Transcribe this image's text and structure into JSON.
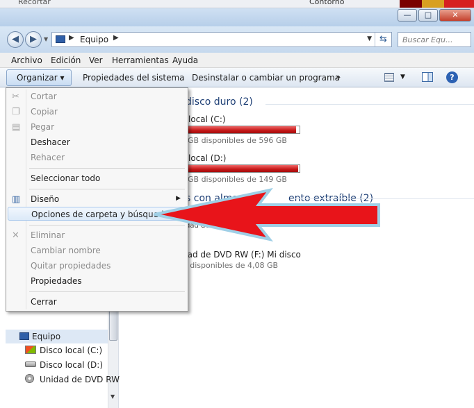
{
  "background_app": {
    "left_label": "Recortar",
    "right_label": "Contorno"
  },
  "window": {
    "min": "—",
    "max": "□",
    "close": "✕"
  },
  "address": {
    "crumb": "Equipo",
    "search_placeholder": "Buscar Equ..."
  },
  "menubar": [
    "Archivo",
    "Edición",
    "Ver",
    "Herramientas",
    "Ayuda"
  ],
  "toolbar": {
    "organize": "Organizar ▾",
    "properties": "Propiedades del sistema",
    "uninstall": "Desinstalar o cambiar un programa",
    "more": "»"
  },
  "nav": {
    "equipo": "Equipo",
    "items": [
      "Disco local (C:)",
      "Disco local (D:)",
      "Unidad de DVD RW"
    ]
  },
  "content": {
    "hdd_group": "disco duro (2)",
    "drive_c_name": "local (C:)",
    "drive_c_free": "GB disponibles de 596 GB",
    "drive_c_used_fraction": 0.97,
    "drive_d_name": "local (D:)",
    "drive_d_free": "GB disponibles de 149 GB",
    "drive_d_used_fraction": 0.99,
    "removable_group_a": "s con alma",
    "removable_group_b": "ento extraíble (2)",
    "hidden_drive_name": "dad de DD",
    "dvd_name": "dad de DVD RW (F:) Mi disco",
    "dvd_free": "s disponibles de 4,08 GB"
  },
  "menu": {
    "cut": "Cortar",
    "copy": "Copiar",
    "paste": "Pegar",
    "undo": "Deshacer",
    "redo": "Rehacer",
    "select_all": "Seleccionar todo",
    "layout": "Diseño",
    "folder_options": "Opciones de carpeta y búsqueda",
    "delete": "Eliminar",
    "rename": "Cambiar nombre",
    "remove_props": "Quitar propiedades",
    "properties": "Propiedades",
    "close": "Cerrar"
  },
  "colors": {
    "arrow": "#e8141a",
    "arrow_border": "#9fcfe6",
    "drive_bar": "#c41717"
  }
}
